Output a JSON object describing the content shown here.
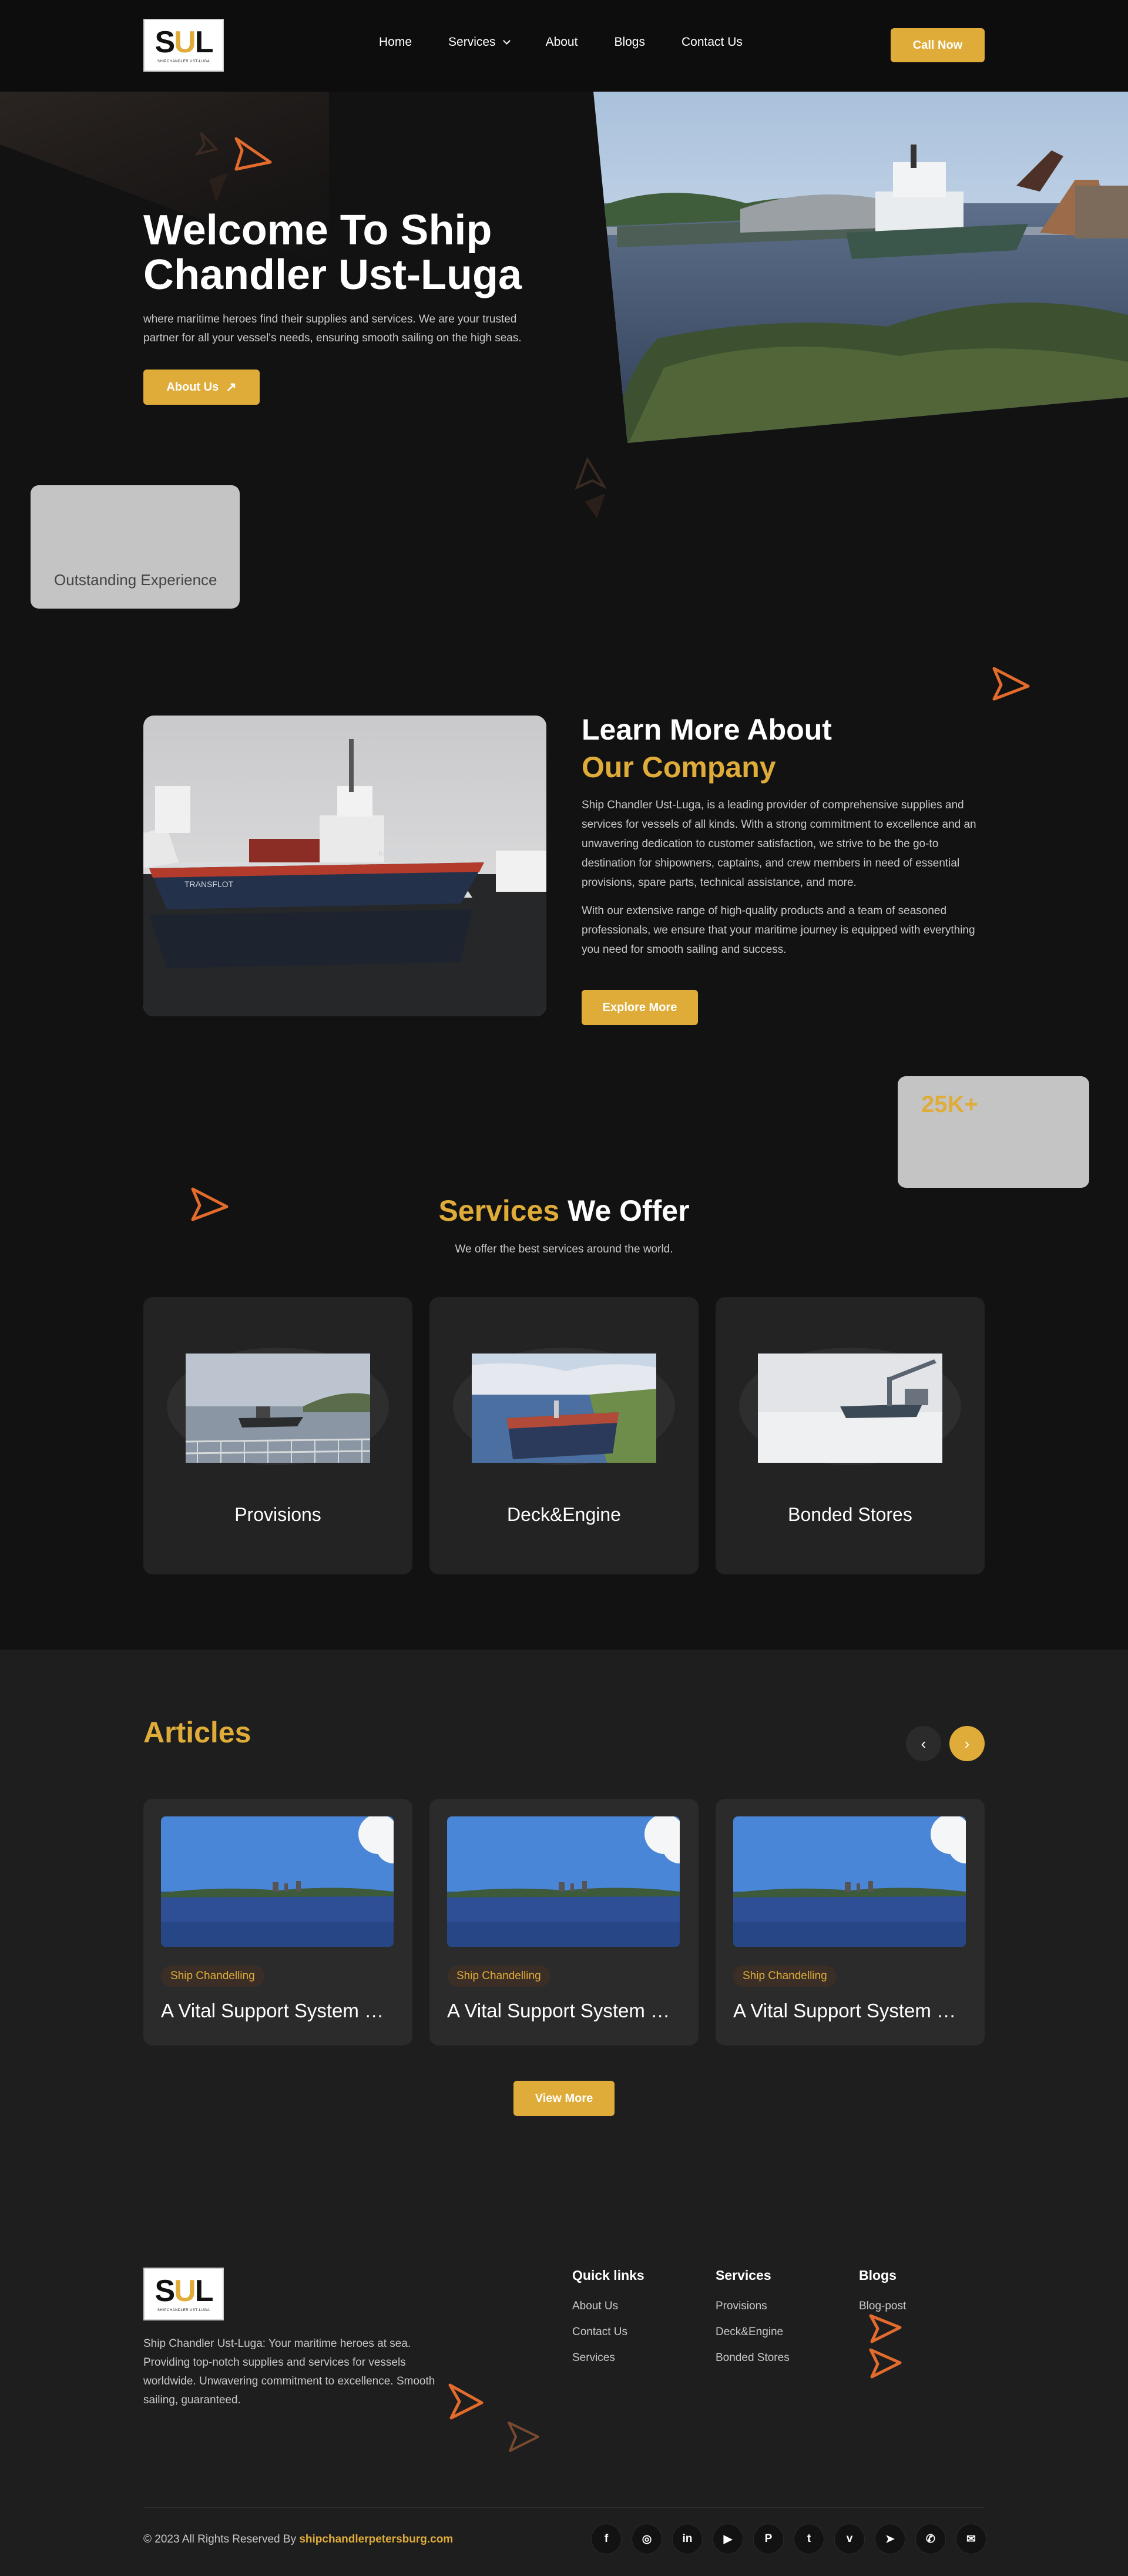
{
  "header": {
    "logo": {
      "mark_left": "S",
      "mark_mid": "U",
      "mark_right": "L",
      "tagline": "SHIPCHANDLER UST-LUGA"
    },
    "nav": [
      {
        "label": "Home"
      },
      {
        "label": "Services"
      },
      {
        "label": "About"
      },
      {
        "label": "Blogs"
      },
      {
        "label": "Contact Us"
      }
    ],
    "cta": "Call Now"
  },
  "hero": {
    "title": "Welcome To Ship Chandler Ust-Luga",
    "text": "where maritime heroes find their supplies and services. We are your trusted partner for all your vessel's needs, ensuring smooth sailing on the high seas.",
    "button": "About Us",
    "floating_card_text": "Outstanding Experience"
  },
  "about": {
    "title_white": "Learn More About",
    "title_gold": "Our Company",
    "p1": "Ship Chandler Ust-Luga, is a leading provider of comprehensive supplies and services for vessels of all kinds. With a strong commitment to excellence and an unwavering dedication to customer satisfaction, we strive to be the go-to destination for shipowners, captains, and crew members in need of essential provisions, spare parts, technical assistance, and more.",
    "p2": "With our extensive range of high-quality products and a team of seasoned professionals, we ensure that your maritime journey is equipped with everything you need for smooth sailing and success.",
    "button": "Explore More",
    "stat": "25K+"
  },
  "services": {
    "title_gold": "Services",
    "title_white": "We Offer",
    "subtitle": "We offer the best services around the world.",
    "items": [
      {
        "label": "Provisions"
      },
      {
        "label": "Deck&Engine"
      },
      {
        "label": "Bonded Stores"
      }
    ]
  },
  "articles": {
    "title": "Articles",
    "items": [
      {
        "tag": "Ship Chandelling",
        "title": "A Vital Support System For Maritime Operations"
      },
      {
        "tag": "Ship Chandelling",
        "title": "A Vital Support System For Maritime Operations"
      },
      {
        "tag": "Ship Chandelling",
        "title": "A Vital Support System For Maritime Operations"
      }
    ],
    "view_more": "View More"
  },
  "footer": {
    "about": "Ship Chandler Ust-Luga: Your maritime heroes at sea. Providing top-notch supplies and services for vessels worldwide. Unwavering commitment to excellence. Smooth sailing, guaranteed.",
    "quick_links": {
      "title": "Quick links",
      "links": [
        "About Us",
        "Contact Us",
        "Services"
      ]
    },
    "services": {
      "title": "Services",
      "links": [
        "Provisions",
        "Deck&Engine",
        "Bonded Stores"
      ]
    },
    "blogs": {
      "title": "Blogs",
      "links": [
        "Blog-post"
      ]
    },
    "copyright": "© 2023 All Rights Reserved By",
    "copyright_link": "shipchandlerpetersburg.com",
    "socials": [
      "f",
      "◎",
      "in",
      "▶",
      "P",
      "t",
      "v",
      "➤",
      "✆",
      "✉"
    ]
  },
  "colors": {
    "accent": "#e0ac39",
    "background": "#121212",
    "card": "#232323",
    "plane_icon": "#e36b2c"
  }
}
